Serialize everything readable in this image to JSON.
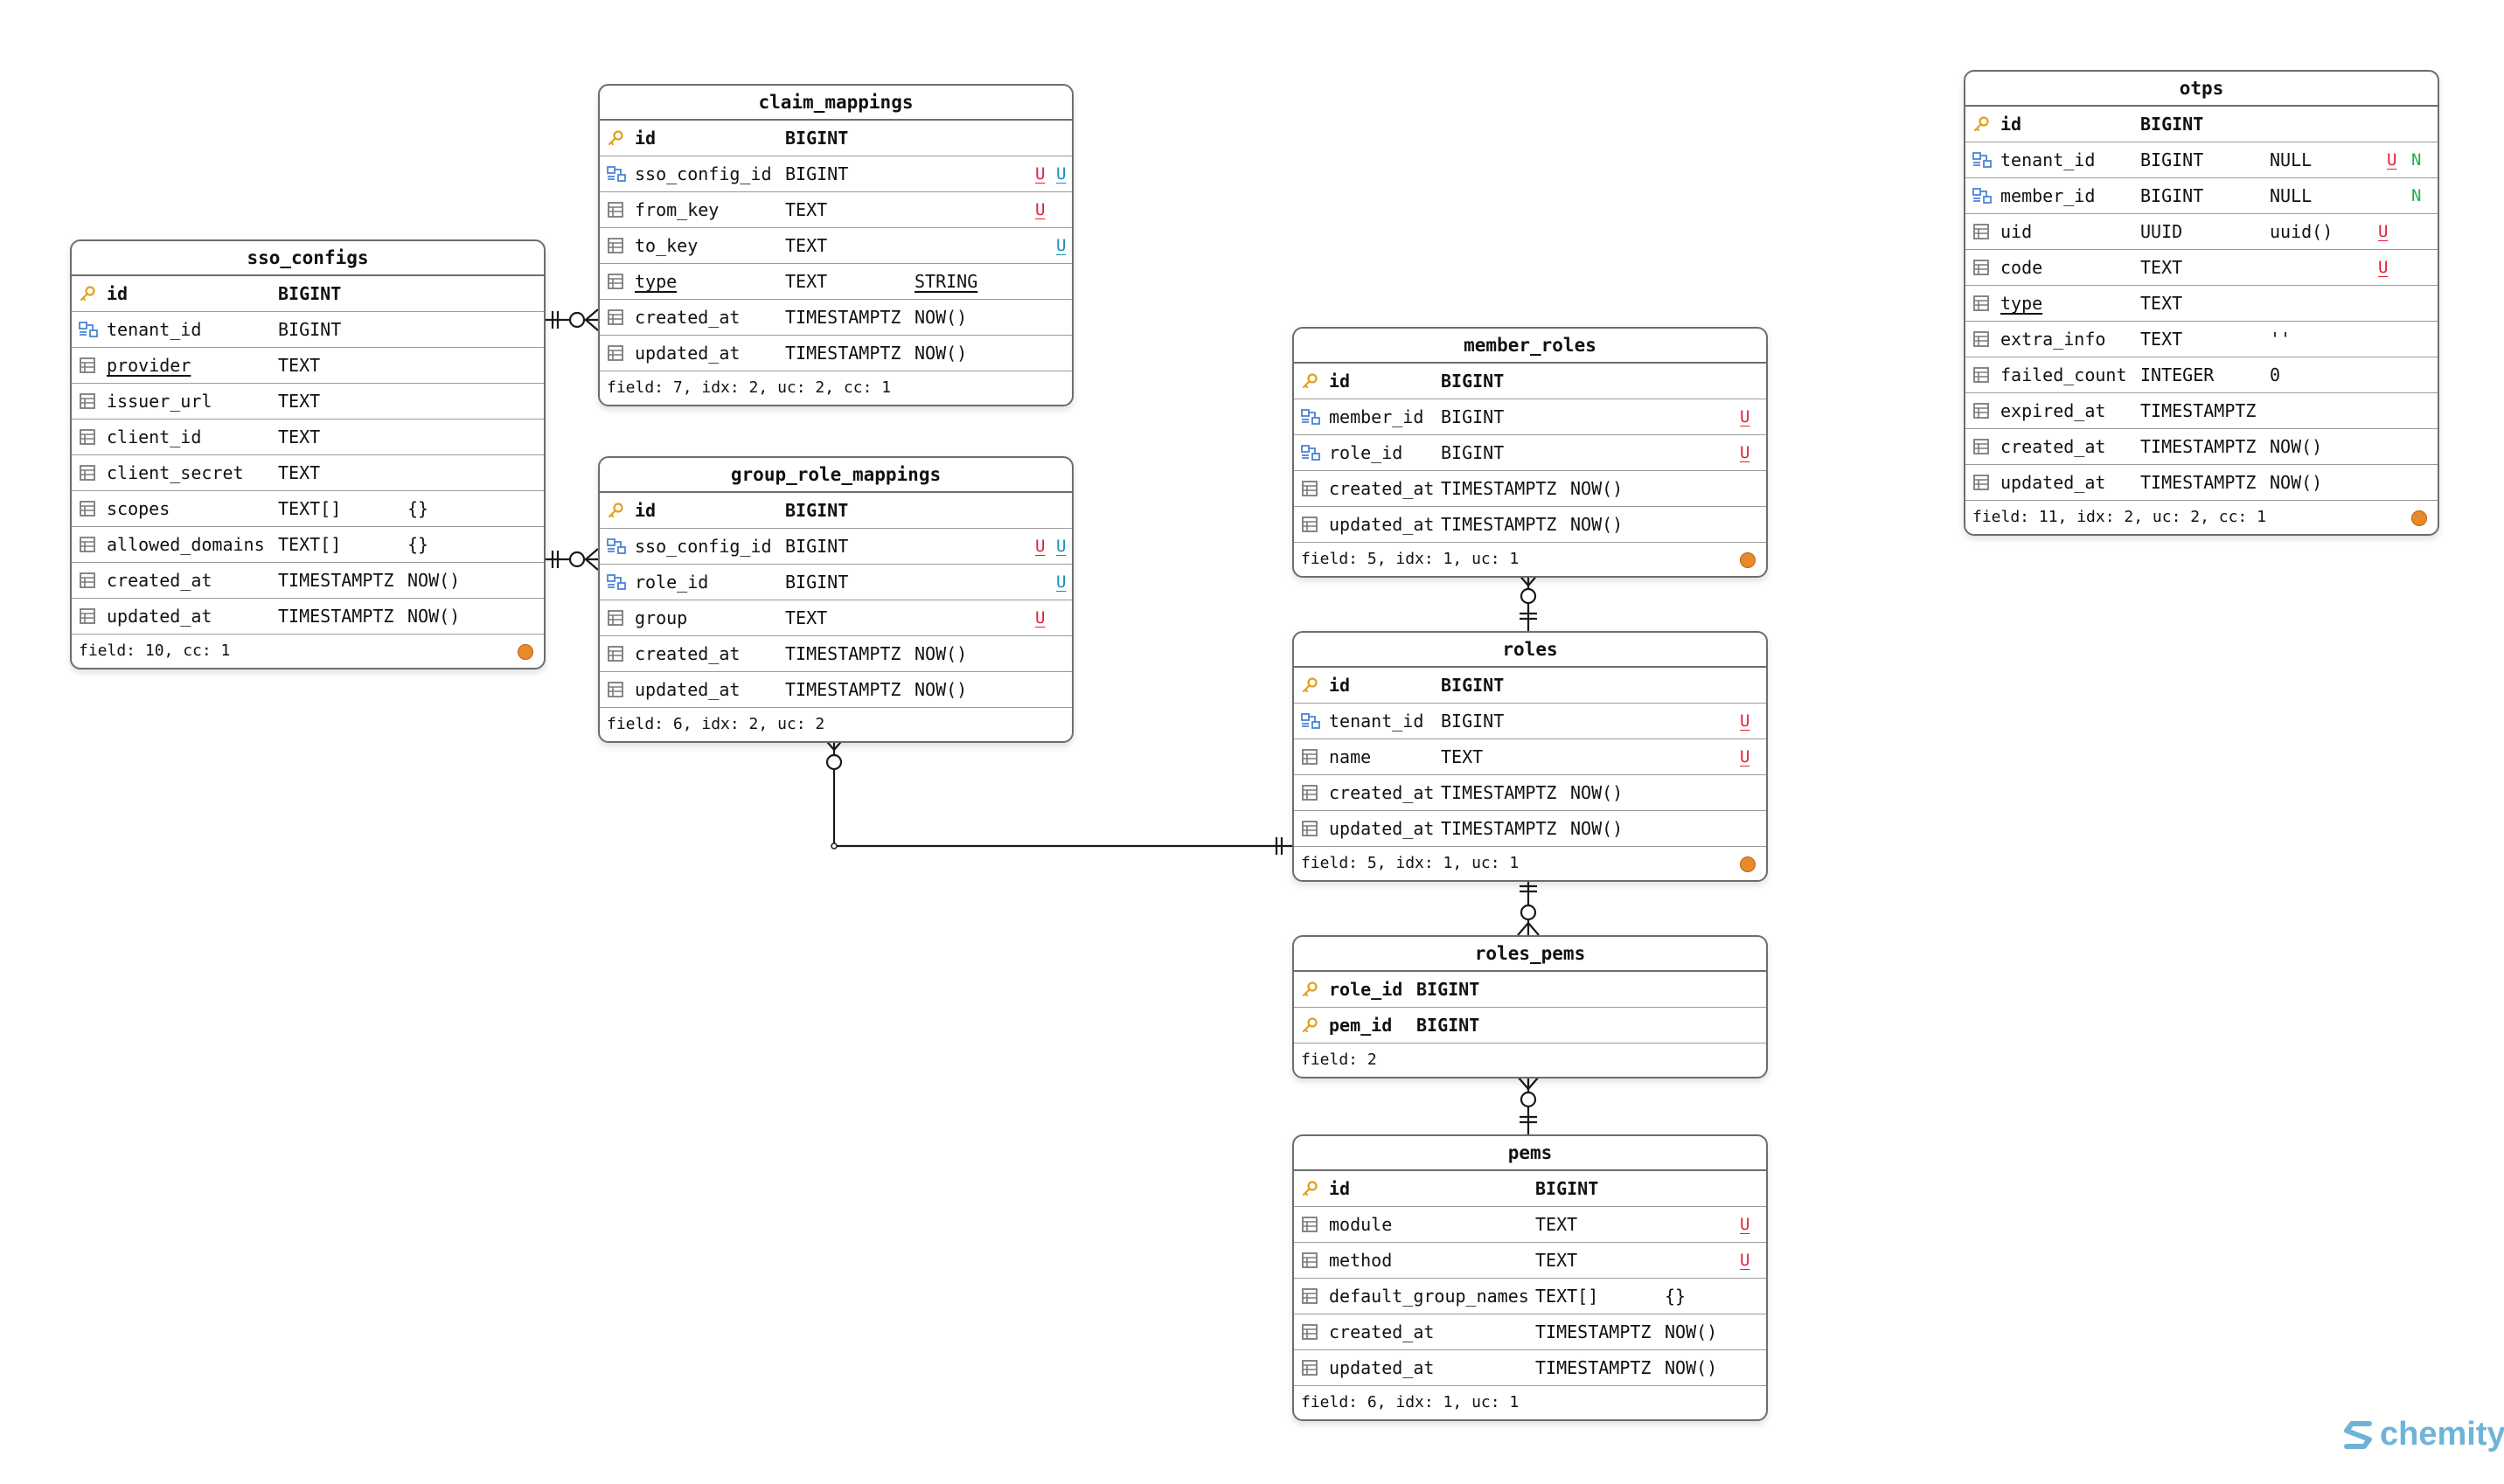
{
  "tables": [
    {
      "key": "sso_configs",
      "title": "sso_configs",
      "rows": [
        {
          "icon": "key",
          "name": "id",
          "type": "BIGINT",
          "default": "",
          "flags": [],
          "pk": true
        },
        {
          "icon": "fk",
          "name": "tenant_id",
          "type": "BIGINT",
          "default": "",
          "flags": []
        },
        {
          "icon": "col",
          "name": "provider",
          "type": "TEXT",
          "default": "",
          "flags": [],
          "underline": true
        },
        {
          "icon": "col",
          "name": "issuer_url",
          "type": "TEXT",
          "default": "",
          "flags": []
        },
        {
          "icon": "col",
          "name": "client_id",
          "type": "TEXT",
          "default": "",
          "flags": []
        },
        {
          "icon": "col",
          "name": "client_secret",
          "type": "TEXT",
          "default": "",
          "flags": []
        },
        {
          "icon": "col",
          "name": "scopes",
          "type": "TEXT[]",
          "default": "{}",
          "flags": []
        },
        {
          "icon": "col",
          "name": "allowed_domains",
          "type": "TEXT[]",
          "default": "{}",
          "flags": []
        },
        {
          "icon": "col",
          "name": "created_at",
          "type": "TIMESTAMPTZ",
          "default": "NOW()",
          "flags": []
        },
        {
          "icon": "col",
          "name": "updated_at",
          "type": "TIMESTAMPTZ",
          "default": "NOW()",
          "flags": []
        }
      ],
      "footer": "field: 10, cc: 1",
      "badge": true
    },
    {
      "key": "claim_mappings",
      "title": "claim_mappings",
      "rows": [
        {
          "icon": "key",
          "name": "id",
          "type": "BIGINT",
          "default": "",
          "flags": [],
          "pk": true
        },
        {
          "icon": "fk",
          "name": "sso_config_id",
          "type": "BIGINT",
          "default": "",
          "flags": [
            {
              "t": "U",
              "c": "u"
            },
            {
              "t": "U",
              "c": "ub"
            }
          ]
        },
        {
          "icon": "col",
          "name": "from_key",
          "type": "TEXT",
          "default": "",
          "flags": [
            {
              "t": "U",
              "c": "u"
            }
          ]
        },
        {
          "icon": "col",
          "name": "to_key",
          "type": "TEXT",
          "default": "",
          "flags": [
            {
              "t": "U",
              "c": "ub"
            }
          ]
        },
        {
          "icon": "col",
          "name": "type",
          "type": "TEXT",
          "default": "STRING",
          "flags": [],
          "underline": true,
          "default_underline": true
        },
        {
          "icon": "col",
          "name": "created_at",
          "type": "TIMESTAMPTZ",
          "default": "NOW()",
          "flags": []
        },
        {
          "icon": "col",
          "name": "updated_at",
          "type": "TIMESTAMPTZ",
          "default": "NOW()",
          "flags": []
        }
      ],
      "footer": "field: 7, idx: 2, uc: 2, cc: 1",
      "badge": false
    },
    {
      "key": "group_role_mappings",
      "title": "group_role_mappings",
      "rows": [
        {
          "icon": "key",
          "name": "id",
          "type": "BIGINT",
          "default": "",
          "flags": [],
          "pk": true
        },
        {
          "icon": "fk",
          "name": "sso_config_id",
          "type": "BIGINT",
          "default": "",
          "flags": [
            {
              "t": "U",
              "c": "u"
            },
            {
              "t": "U",
              "c": "ub"
            }
          ]
        },
        {
          "icon": "fk",
          "name": "role_id",
          "type": "BIGINT",
          "default": "",
          "flags": [
            {
              "t": "U",
              "c": "ub"
            }
          ]
        },
        {
          "icon": "col",
          "name": "group",
          "type": "TEXT",
          "default": "",
          "flags": [
            {
              "t": "U",
              "c": "u"
            }
          ]
        },
        {
          "icon": "col",
          "name": "created_at",
          "type": "TIMESTAMPTZ",
          "default": "NOW()",
          "flags": []
        },
        {
          "icon": "col",
          "name": "updated_at",
          "type": "TIMESTAMPTZ",
          "default": "NOW()",
          "flags": []
        }
      ],
      "footer": "field: 6, idx: 2, uc: 2",
      "badge": false
    },
    {
      "key": "member_roles",
      "title": "member_roles",
      "rows": [
        {
          "icon": "key",
          "name": "id",
          "type": "BIGINT",
          "default": "",
          "flags": [],
          "pk": true
        },
        {
          "icon": "fk",
          "name": "member_id",
          "type": "BIGINT",
          "default": "",
          "flags": [
            {
              "t": "U",
              "c": "u"
            }
          ]
        },
        {
          "icon": "fk",
          "name": "role_id",
          "type": "BIGINT",
          "default": "",
          "flags": [
            {
              "t": "U",
              "c": "u"
            }
          ]
        },
        {
          "icon": "col",
          "name": "created_at",
          "type": "TIMESTAMPTZ",
          "default": "NOW()",
          "flags": []
        },
        {
          "icon": "col",
          "name": "updated_at",
          "type": "TIMESTAMPTZ",
          "default": "NOW()",
          "flags": []
        }
      ],
      "footer": "field: 5, idx: 1, uc: 1",
      "badge": true
    },
    {
      "key": "roles",
      "title": "roles",
      "rows": [
        {
          "icon": "key",
          "name": "id",
          "type": "BIGINT",
          "default": "",
          "flags": [],
          "pk": true
        },
        {
          "icon": "fk",
          "name": "tenant_id",
          "type": "BIGINT",
          "default": "",
          "flags": [
            {
              "t": "U",
              "c": "u"
            }
          ]
        },
        {
          "icon": "col",
          "name": "name",
          "type": "TEXT",
          "default": "",
          "flags": [
            {
              "t": "U",
              "c": "u"
            }
          ]
        },
        {
          "icon": "col",
          "name": "created_at",
          "type": "TIMESTAMPTZ",
          "default": "NOW()",
          "flags": []
        },
        {
          "icon": "col",
          "name": "updated_at",
          "type": "TIMESTAMPTZ",
          "default": "NOW()",
          "flags": []
        }
      ],
      "footer": "field: 5, idx: 1, uc: 1",
      "badge": true
    },
    {
      "key": "roles_pems",
      "title": "roles_pems",
      "rows": [
        {
          "icon": "key",
          "name": "role_id",
          "type": "BIGINT",
          "default": "",
          "flags": [],
          "pk": true
        },
        {
          "icon": "key",
          "name": "pem_id",
          "type": "BIGINT",
          "default": "",
          "flags": [],
          "pk": true
        }
      ],
      "footer": "field: 2",
      "badge": false
    },
    {
      "key": "pems",
      "title": "pems",
      "rows": [
        {
          "icon": "key",
          "name": "id",
          "type": "BIGINT",
          "default": "",
          "flags": [],
          "pk": true
        },
        {
          "icon": "col",
          "name": "module",
          "type": "TEXT",
          "default": "",
          "flags": [
            {
              "t": "U",
              "c": "u"
            }
          ]
        },
        {
          "icon": "col",
          "name": "method",
          "type": "TEXT",
          "default": "",
          "flags": [
            {
              "t": "U",
              "c": "u"
            }
          ]
        },
        {
          "icon": "col",
          "name": "default_group_names",
          "type": "TEXT[]",
          "default": "{}",
          "flags": []
        },
        {
          "icon": "col",
          "name": "created_at",
          "type": "TIMESTAMPTZ",
          "default": "NOW()",
          "flags": []
        },
        {
          "icon": "col",
          "name": "updated_at",
          "type": "TIMESTAMPTZ",
          "default": "NOW()",
          "flags": []
        }
      ],
      "footer": "field: 6, idx: 1, uc: 1",
      "badge": false
    },
    {
      "key": "otps",
      "title": "otps",
      "rows": [
        {
          "icon": "key",
          "name": "id",
          "type": "BIGINT",
          "default": "",
          "flags": [],
          "pk": true
        },
        {
          "icon": "fk",
          "name": "tenant_id",
          "type": "BIGINT",
          "default": "NULL",
          "flags": [
            {
              "t": "U",
              "c": "u"
            },
            {
              "t": "N",
              "c": "n"
            }
          ]
        },
        {
          "icon": "fk",
          "name": "member_id",
          "type": "BIGINT",
          "default": "NULL",
          "flags": [
            {
              "t": "N",
              "c": "n"
            }
          ]
        },
        {
          "icon": "col",
          "name": "uid",
          "type": "UUID",
          "default": "uuid()",
          "flags": [
            {
              "t": "U",
              "c": "u"
            }
          ]
        },
        {
          "icon": "col",
          "name": "code",
          "type": "TEXT",
          "default": "",
          "flags": [
            {
              "t": "U",
              "c": "u"
            }
          ]
        },
        {
          "icon": "col",
          "name": "type",
          "type": "TEXT",
          "default": "",
          "flags": [],
          "underline": true
        },
        {
          "icon": "col",
          "name": "extra_info",
          "type": "TEXT",
          "default": "''",
          "flags": []
        },
        {
          "icon": "col",
          "name": "failed_count",
          "type": "INTEGER",
          "default": "0",
          "flags": []
        },
        {
          "icon": "col",
          "name": "expired_at",
          "type": "TIMESTAMPTZ",
          "default": "",
          "flags": []
        },
        {
          "icon": "col",
          "name": "created_at",
          "type": "TIMESTAMPTZ",
          "default": "NOW()",
          "flags": []
        },
        {
          "icon": "col",
          "name": "updated_at",
          "type": "TIMESTAMPTZ",
          "default": "NOW()",
          "flags": []
        }
      ],
      "footer": "field: 11, idx: 2, uc: 2, cc: 1",
      "badge": true
    }
  ],
  "logo": {
    "text": "chemity"
  },
  "colors": {
    "border": "#6d6d6d",
    "unique_red": "#e0203a",
    "unique_blue": "#1a8fb8",
    "nullable_green": "#1fae4a",
    "badge": "#e8892c",
    "key_icon": "#e2a01f",
    "fk_icon": "#4a84d6",
    "logo": "#6fb4d8"
  }
}
